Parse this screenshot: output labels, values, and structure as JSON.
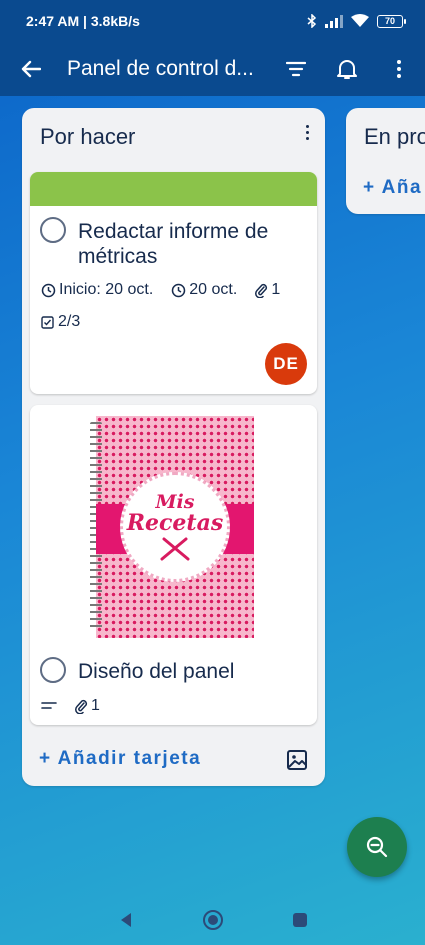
{
  "status_bar": {
    "time_speed": "2:47 AM | 3.8kB/s",
    "battery": "70"
  },
  "app_bar": {
    "title": "Panel de control d..."
  },
  "lists": [
    {
      "title": "Por hacer",
      "cards": [
        {
          "cover_color": "#8bc34a",
          "title_line1": "Redactar informe de",
          "title_line2": "métricas",
          "start_date": "Inicio: 20 oct.",
          "due_date": "20 oct.",
          "attachments": "1",
          "checklist": "2/3",
          "member_initials": "DE"
        },
        {
          "cover_image": {
            "line1": "Mis",
            "line2": "Recetas"
          },
          "title": "Diseño del panel",
          "attachments": "1"
        }
      ],
      "add_card_label": "+ Añadir tarjeta"
    },
    {
      "title": "En pro",
      "add_card_label": "+ Aña"
    }
  ],
  "icons": {
    "back": "back-arrow-icon",
    "filter": "filter-icon",
    "notifications": "bell-icon",
    "more": "more-vertical-icon",
    "zoom_out": "zoom-out-icon"
  },
  "colors": {
    "app_bar": "#0a4a8f",
    "link": "#1f6bc4",
    "avatar": "#d93a0c",
    "fab": "#1d7f4f",
    "label_green": "#8bc34a"
  }
}
